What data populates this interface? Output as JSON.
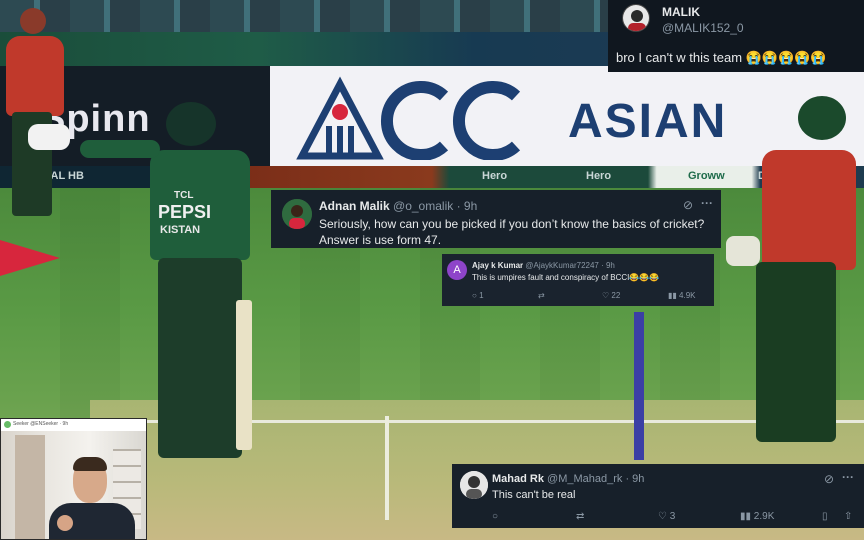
{
  "background": {
    "boards": {
      "spinny": "Spinn",
      "acc": "ACC",
      "asian": "ASIAN",
      "strip_left": "VAL HB",
      "strip_hero1": "Hero",
      "strip_hero2": "Hero",
      "strip_groww": "Groww",
      "strip_dp": "DP"
    },
    "jersey": {
      "line1": "TCL",
      "line2": "PEPSI",
      "line3": "KISTAN"
    }
  },
  "tweets": {
    "malik": {
      "name": "MALIK",
      "handle": "@MALIK152_0",
      "text": "bro I can't w this team 😭😭😭😭😭"
    },
    "adnan": {
      "name": "Adnan Malik",
      "handle_time": "@o_omalik · 9h",
      "text": "Seriously, how can you be picked if you don’t know the basics of cricket? Answer is use form 47."
    },
    "ajay": {
      "avatar_letter": "A",
      "name": "Ajay k Kumar",
      "handle_time": "@AjaykKumar72247 · 9h",
      "text": "This is umpires fault and conspiracy of BCCI😂😂😂",
      "replies": "1",
      "likes": "22",
      "views": "4.9K"
    },
    "mahad": {
      "name": "Mahad Rk",
      "handle_time": "@M_Mahad_rk · 9h",
      "text": "This can't be real",
      "likes": "3",
      "views": "2.9K"
    }
  },
  "webcam": {
    "caption": "Seeker @ENSeeker · 9h"
  },
  "icons": {
    "more": "···",
    "grok": "⊘",
    "reply": "○",
    "retweet": "⇄",
    "like": "♡",
    "views": "📊",
    "bookmark": "▯",
    "share": "⇧"
  }
}
